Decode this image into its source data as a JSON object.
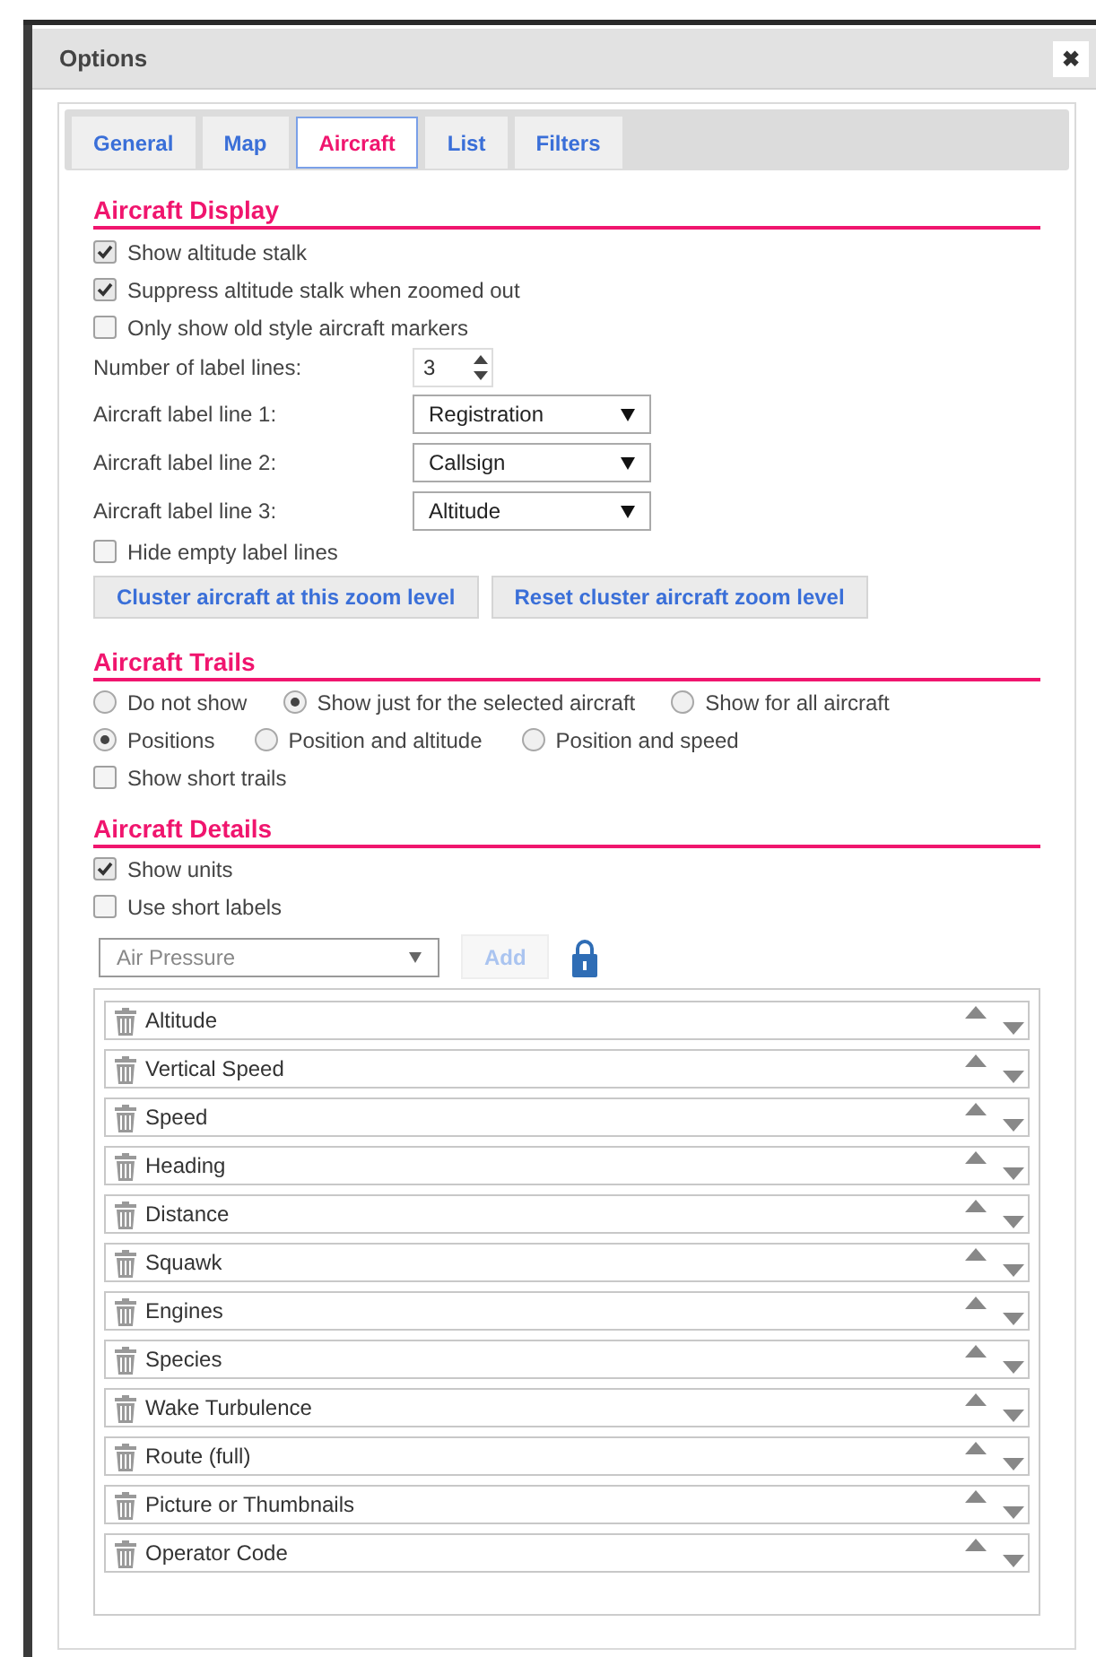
{
  "window": {
    "title": "Options",
    "close": "✖"
  },
  "tabs": [
    {
      "label": "General",
      "selected": false
    },
    {
      "label": "Map",
      "selected": false
    },
    {
      "label": "Aircraft",
      "selected": true
    },
    {
      "label": "List",
      "selected": false
    },
    {
      "label": "Filters",
      "selected": false
    }
  ],
  "display": {
    "heading": "Aircraft Display",
    "checkboxes": [
      {
        "label": "Show altitude stalk",
        "checked": true
      },
      {
        "label": "Suppress altitude stalk when zoomed out",
        "checked": true
      },
      {
        "label": "Only show old style aircraft markers",
        "checked": false
      }
    ],
    "label_lines": {
      "label": "Number of label lines:",
      "value": "3"
    },
    "selects": [
      {
        "label": "Aircraft label line 1:",
        "value": "Registration"
      },
      {
        "label": "Aircraft label line 2:",
        "value": "Callsign"
      },
      {
        "label": "Aircraft label line 3:",
        "value": "Altitude"
      }
    ],
    "hide_empty": {
      "label": "Hide empty label lines",
      "checked": false
    },
    "buttons": [
      "Cluster aircraft at this zoom level",
      "Reset cluster aircraft zoom level"
    ]
  },
  "trails": {
    "heading": "Aircraft Trails",
    "radio_rows": [
      [
        {
          "label": "Do not show",
          "selected": false
        },
        {
          "label": "Show just for the selected aircraft",
          "selected": true
        },
        {
          "label": "Show for all aircraft",
          "selected": false
        }
      ],
      [
        {
          "label": "Positions",
          "selected": true
        },
        {
          "label": "Position and altitude",
          "selected": false
        },
        {
          "label": "Position and speed",
          "selected": false
        }
      ]
    ],
    "short_trails": {
      "label": "Show short trails",
      "checked": false
    }
  },
  "details": {
    "heading": "Aircraft Details",
    "checkboxes": [
      {
        "label": "Show units",
        "checked": true
      },
      {
        "label": "Use short labels",
        "checked": false
      }
    ],
    "add_select": {
      "value": "Air Pressure"
    },
    "add_button": {
      "label": "Add",
      "disabled": true
    },
    "items": [
      "Altitude",
      "Vertical Speed",
      "Speed",
      "Heading",
      "Distance",
      "Squawk",
      "Engines",
      "Species",
      "Wake Turbulence",
      "Route (full)",
      "Picture or Thumbnails",
      "Operator Code"
    ]
  }
}
